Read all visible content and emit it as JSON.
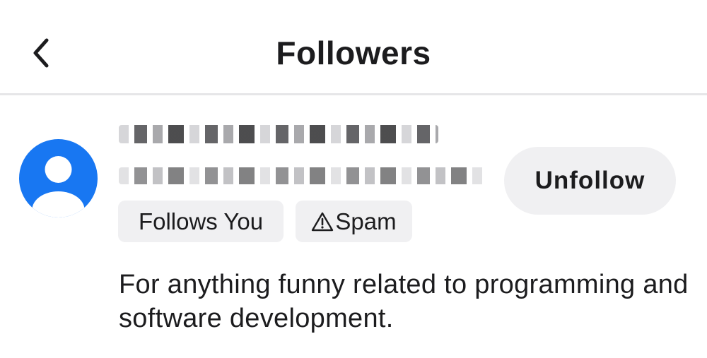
{
  "header": {
    "title": "Followers",
    "back_icon": "chevron-left-icon"
  },
  "follower": {
    "name_redacted": true,
    "avatar_color": "#1877f2",
    "tags": [
      {
        "label": "Follows You"
      },
      {
        "label": "Spam",
        "icon": "warning-triangle-icon"
      }
    ],
    "action_label": "Unfollow",
    "bio": "For anything funny related to programming and software development."
  },
  "colors": {
    "accent": "#1877f2",
    "chip_bg": "#f0f0f2",
    "text": "#1c1c1e",
    "divider": "#e6e6e8"
  }
}
